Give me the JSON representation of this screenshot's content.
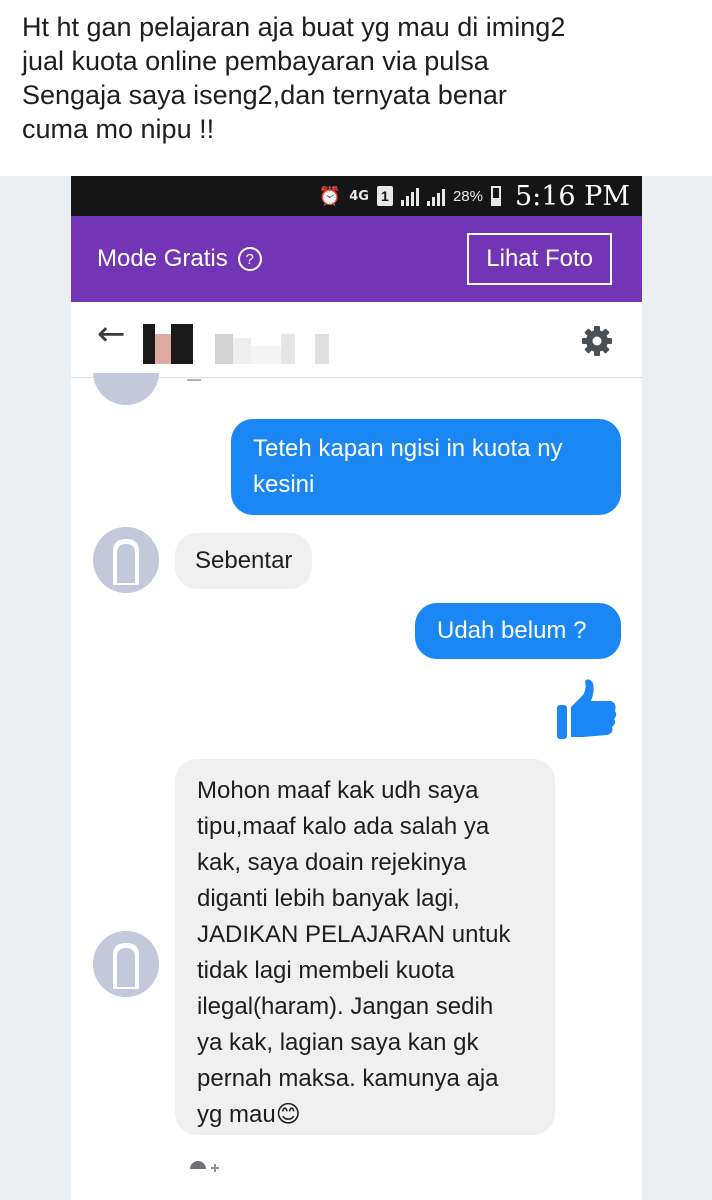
{
  "post": {
    "caption_lines": [
      "Ht ht gan pelajaran aja buat yg mau di iming2",
      "jual kuota online pembayaran via pulsa",
      "Sengaja saya iseng2,dan ternyata benar",
      "cuma mo nipu !!"
    ]
  },
  "status_bar": {
    "network": "4G",
    "sim": "1",
    "battery": "28%",
    "time": "5:16 PM"
  },
  "promo_bar": {
    "title": "Mode Gratis",
    "help_glyph": "?",
    "button_label": "Lihat Foto",
    "color": "#7335b5"
  },
  "chat_header": {
    "back_glyph": "←"
  },
  "messages": [
    {
      "direction": "out",
      "text_lines": [
        "Teteh kapan ngisi in kuota ny",
        "kesini"
      ]
    },
    {
      "direction": "in",
      "text_lines": [
        "Sebentar"
      ]
    },
    {
      "direction": "out",
      "text_lines": [
        "Udah belum ?"
      ]
    },
    {
      "direction": "out",
      "sticker": "thumbs-up"
    },
    {
      "direction": "in",
      "text_lines": [
        "Mohon maaf kak udh saya",
        "tipu,maaf kalo ada salah ya",
        "kak, saya doain rejekinya",
        "diganti lebih banyak lagi,",
        "JADIKAN PELAJARAN untuk",
        "tidak lagi membeli kuota",
        "ilegal(haram). Jangan sedih",
        "ya kak, lagian saya kan gk",
        "pernah maksa. kamunya aja",
        "yg mau😊"
      ]
    }
  ],
  "colors": {
    "outgoing_bubble": "#1a87f5",
    "incoming_bubble": "#f1f0f0",
    "avatar": "#c3c8da"
  }
}
